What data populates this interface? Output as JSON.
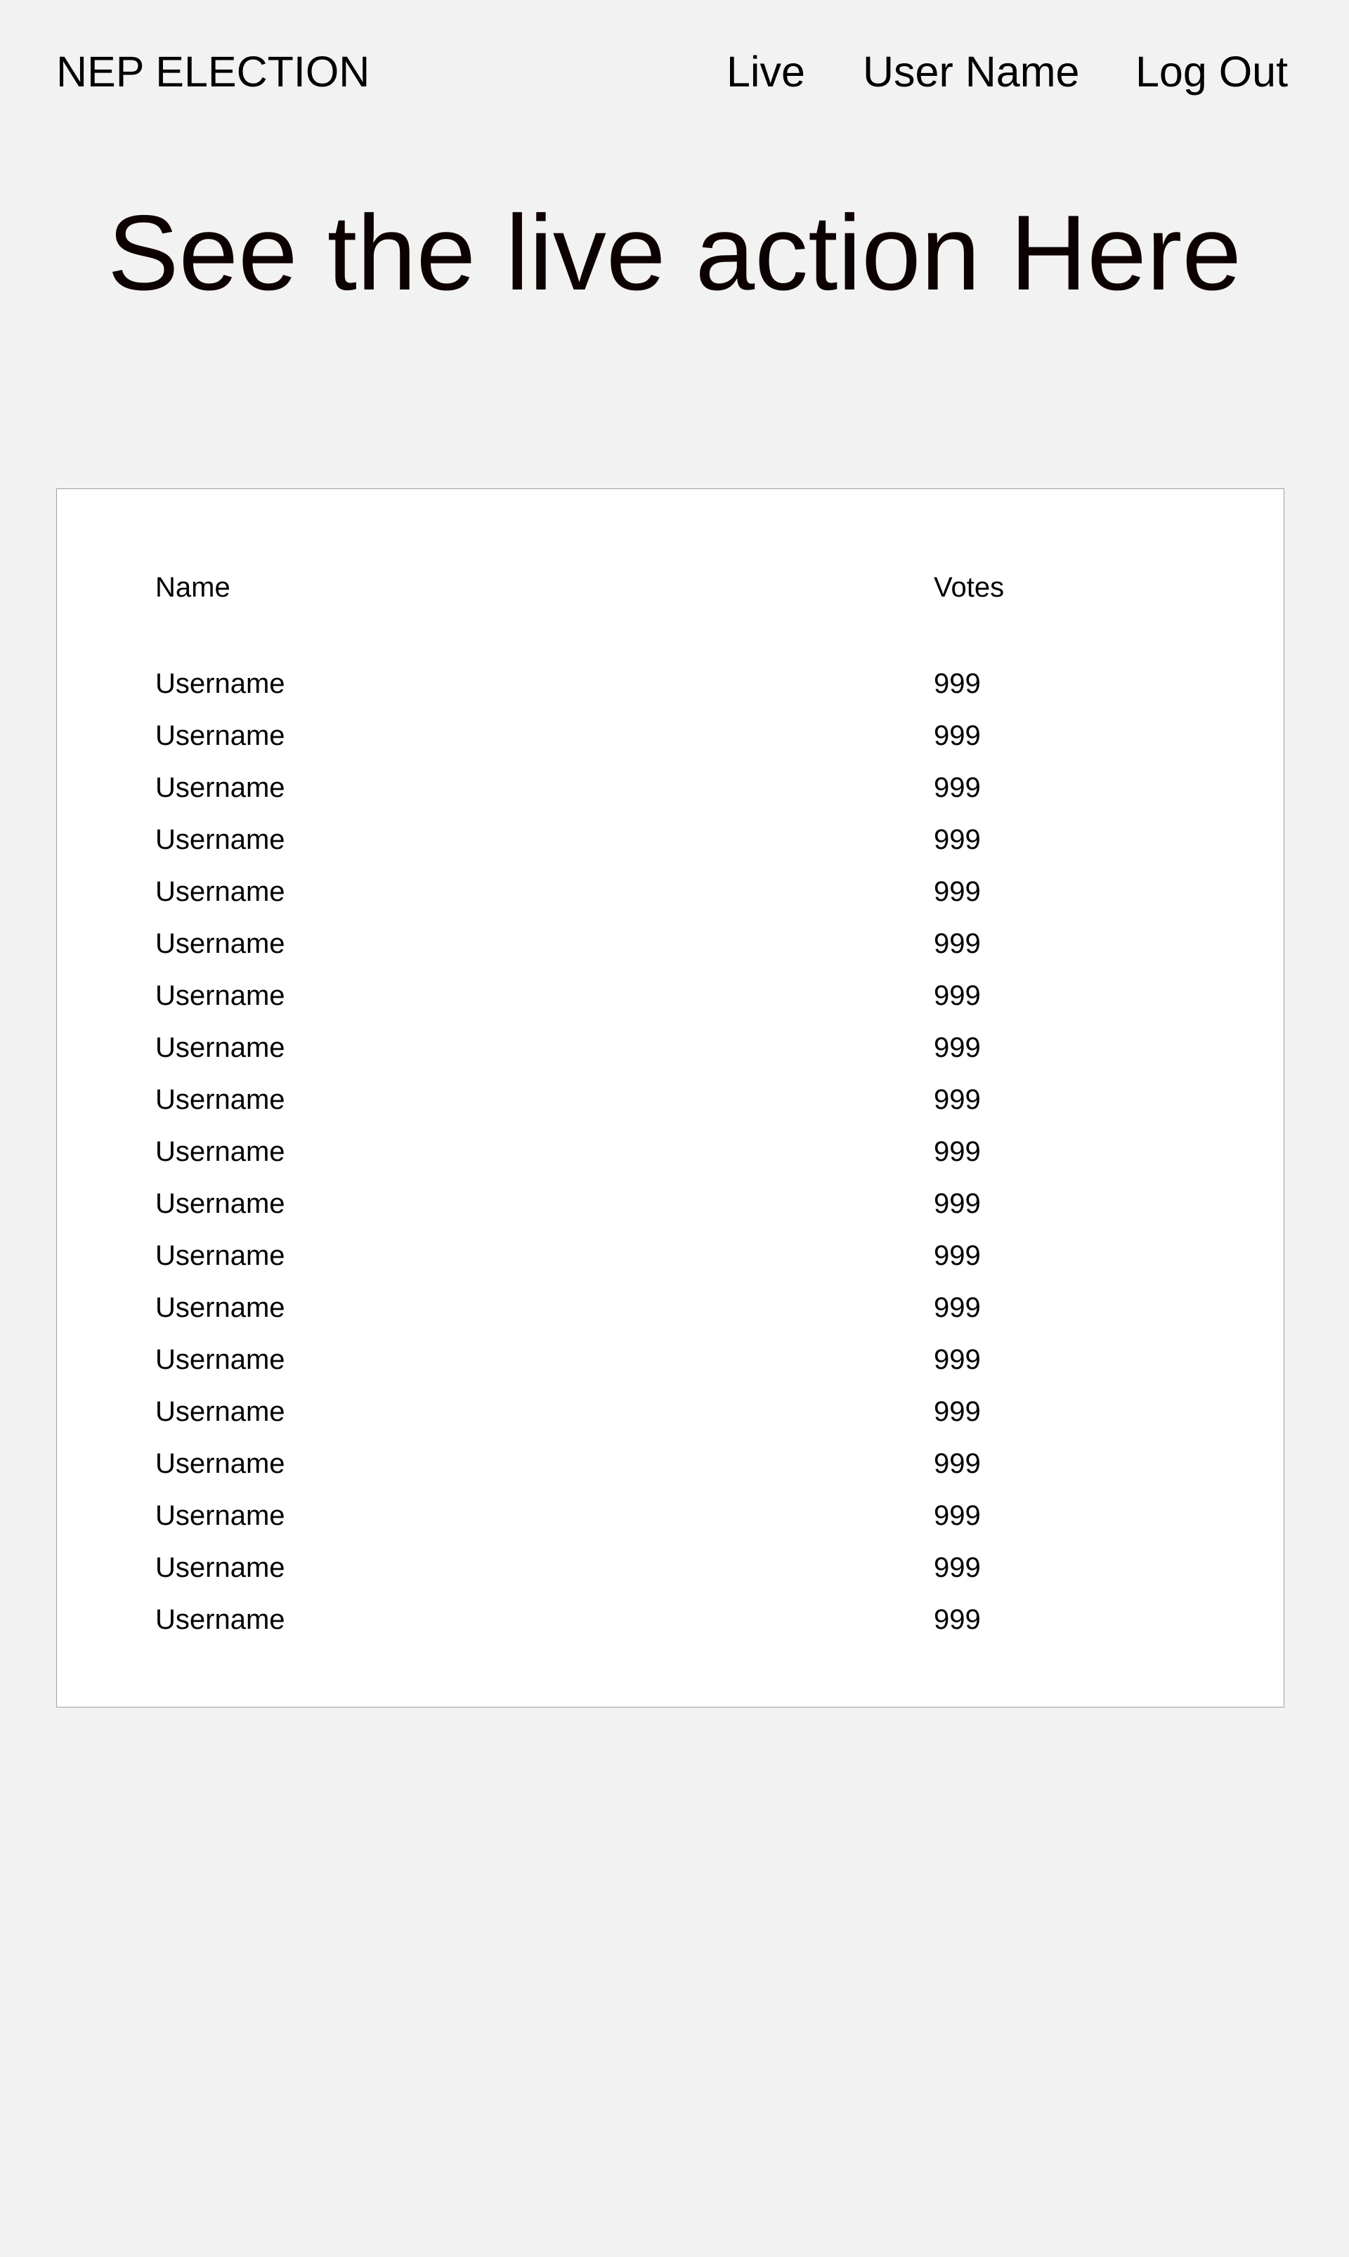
{
  "header": {
    "brand": "NEP ELECTION",
    "nav": {
      "live": "Live",
      "user_name": "User Name",
      "logout": "Log Out"
    }
  },
  "hero": {
    "title": "See the live action Here"
  },
  "table": {
    "columns": [
      "Name",
      "Votes"
    ],
    "rows": [
      {
        "name": "Username",
        "votes": "999"
      },
      {
        "name": "Username",
        "votes": "999"
      },
      {
        "name": "Username",
        "votes": "999"
      },
      {
        "name": "Username",
        "votes": "999"
      },
      {
        "name": "Username",
        "votes": "999"
      },
      {
        "name": "Username",
        "votes": "999"
      },
      {
        "name": "Username",
        "votes": "999"
      },
      {
        "name": "Username",
        "votes": "999"
      },
      {
        "name": "Username",
        "votes": "999"
      },
      {
        "name": "Username",
        "votes": "999"
      },
      {
        "name": "Username",
        "votes": "999"
      },
      {
        "name": "Username",
        "votes": "999"
      },
      {
        "name": "Username",
        "votes": "999"
      },
      {
        "name": "Username",
        "votes": "999"
      },
      {
        "name": "Username",
        "votes": "999"
      },
      {
        "name": "Username",
        "votes": "999"
      },
      {
        "name": "Username",
        "votes": "999"
      },
      {
        "name": "Username",
        "votes": "999"
      },
      {
        "name": "Username",
        "votes": "999"
      }
    ]
  }
}
